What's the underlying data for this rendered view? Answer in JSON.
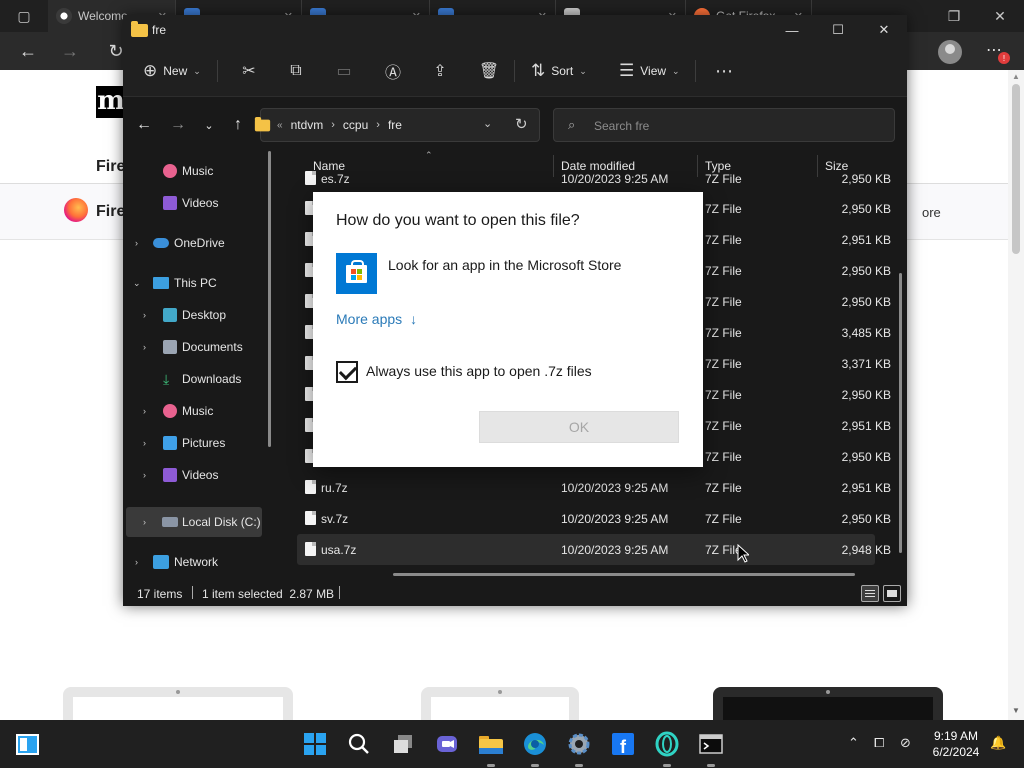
{
  "browser": {
    "tabs": [
      {
        "label": "Welcome",
        "icon": "edge-icon"
      },
      {
        "label": "",
        "icon": "blue-icon"
      },
      {
        "label": "",
        "icon": "blue-icon"
      },
      {
        "label": "",
        "icon": "blue-icon"
      },
      {
        "label": "",
        "icon": "document-icon"
      },
      {
        "label": "Get Firefox",
        "icon": "firefox-icon"
      }
    ],
    "page": {
      "logo_text": "m",
      "heading": "Fire",
      "firefox_label": "Fire",
      "more_text": "ore"
    }
  },
  "explorer": {
    "title": "fre",
    "commands": {
      "new_label": "New",
      "sort_label": "Sort",
      "view_label": "View"
    },
    "address": {
      "crumbs": [
        "ntdvm",
        "ccpu",
        "fre"
      ]
    },
    "search": {
      "placeholder": "Search fre"
    },
    "nav": {
      "items": [
        {
          "label": "Music"
        },
        {
          "label": "Videos"
        },
        {
          "label": "OneDrive"
        },
        {
          "label": "This PC"
        },
        {
          "label": "Desktop"
        },
        {
          "label": "Documents"
        },
        {
          "label": "Downloads"
        },
        {
          "label": "Music"
        },
        {
          "label": "Pictures"
        },
        {
          "label": "Videos"
        },
        {
          "label": "Local Disk (C:)"
        },
        {
          "label": "Network"
        }
      ]
    },
    "columns": {
      "name": "Name",
      "date": "Date modified",
      "type": "Type",
      "size": "Size"
    },
    "files": [
      {
        "name": "es.7z",
        "date": "10/20/2023 9:25 AM",
        "type": "7Z File",
        "size": "2,950 KB"
      },
      {
        "name": "",
        "date": "",
        "type": "7Z File",
        "size": "2,950 KB"
      },
      {
        "name": "",
        "date": "",
        "type": "7Z File",
        "size": "2,951 KB"
      },
      {
        "name": "",
        "date": "",
        "type": "7Z File",
        "size": "2,950 KB"
      },
      {
        "name": "",
        "date": "",
        "type": "7Z File",
        "size": "2,950 KB"
      },
      {
        "name": "",
        "date": "",
        "type": "7Z File",
        "size": "3,485 KB"
      },
      {
        "name": "",
        "date": "",
        "type": "7Z File",
        "size": "3,371 KB"
      },
      {
        "name": "",
        "date": "",
        "type": "7Z File",
        "size": "2,950 KB"
      },
      {
        "name": "",
        "date": "",
        "type": "7Z File",
        "size": "2,951 KB"
      },
      {
        "name": "",
        "date": "",
        "type": "7Z File",
        "size": "2,950 KB"
      },
      {
        "name": "ru.7z",
        "date": "10/20/2023 9:25 AM",
        "type": "7Z File",
        "size": "2,951 KB"
      },
      {
        "name": "sv.7z",
        "date": "10/20/2023 9:25 AM",
        "type": "7Z File",
        "size": "2,950 KB"
      },
      {
        "name": "usa.7z",
        "date": "10/20/2023 9:25 AM",
        "type": "7Z File",
        "size": "2,948 KB"
      }
    ],
    "status": {
      "items": "17 items",
      "selection": "1 item selected  2.87 MB"
    }
  },
  "dialog": {
    "title": "How do you want to open this file?",
    "store_label": "Look for an app in the Microsoft Store",
    "more_apps": "More apps",
    "always_use": "Always use this app to open .7z files",
    "always_use_checked": true,
    "ok_label": "OK"
  },
  "taskbar": {
    "apps": [
      "start-icon",
      "search-icon",
      "task-view-icon",
      "teams-chat-icon",
      "file-explorer-icon",
      "edge-icon",
      "settings-icon",
      "facebook-icon",
      "opera-icon",
      "terminal-icon"
    ],
    "time": "9:19 AM",
    "date": "6/2/2024",
    "accent": "#2aa3f0"
  }
}
